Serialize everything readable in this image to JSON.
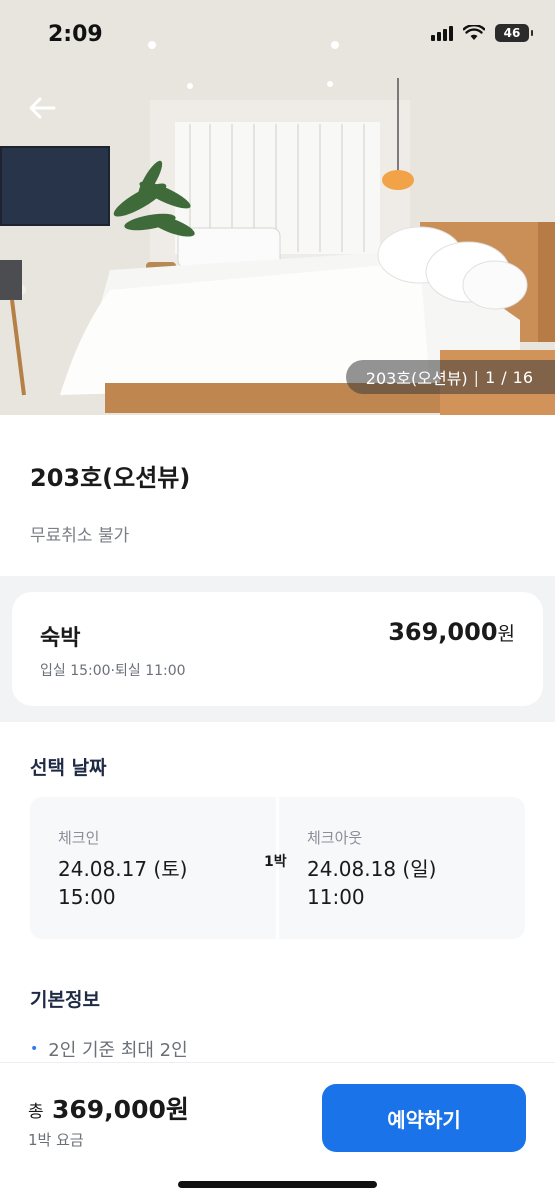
{
  "status_bar": {
    "time": "2:09",
    "battery": "46"
  },
  "gallery": {
    "room_name": "203호(오션뷰)",
    "separator": "|",
    "current": "1",
    "slash": "/",
    "total": "16"
  },
  "room": {
    "title": "203호(오션뷰)",
    "cancel_policy": "무료취소 불가"
  },
  "stay": {
    "label": "숙박",
    "times": "입실 15:00·퇴실 11:00",
    "price": "369,000",
    "currency": "원"
  },
  "dates": {
    "section_title": "선택 날짜",
    "checkin_label": "체크인",
    "checkin_date": "24.08.17 (토)",
    "checkin_time": "15:00",
    "nights": "1박",
    "checkout_label": "체크아웃",
    "checkout_date": "24.08.18 (일)",
    "checkout_time": "11:00"
  },
  "basic_info": {
    "section_title": "기본정보",
    "items": [
      "2인 기준 최대 2인"
    ]
  },
  "footer": {
    "total_prefix": "총",
    "total_amount": "369,000원",
    "sub": "1박 요금",
    "book_button": "예약하기"
  },
  "colors": {
    "accent": "#1a73e8",
    "bullet": "#3478f6"
  },
  "icons": {
    "back": "arrow-left-icon",
    "signal": "signal-icon",
    "wifi": "wifi-icon",
    "battery": "battery-icon"
  }
}
